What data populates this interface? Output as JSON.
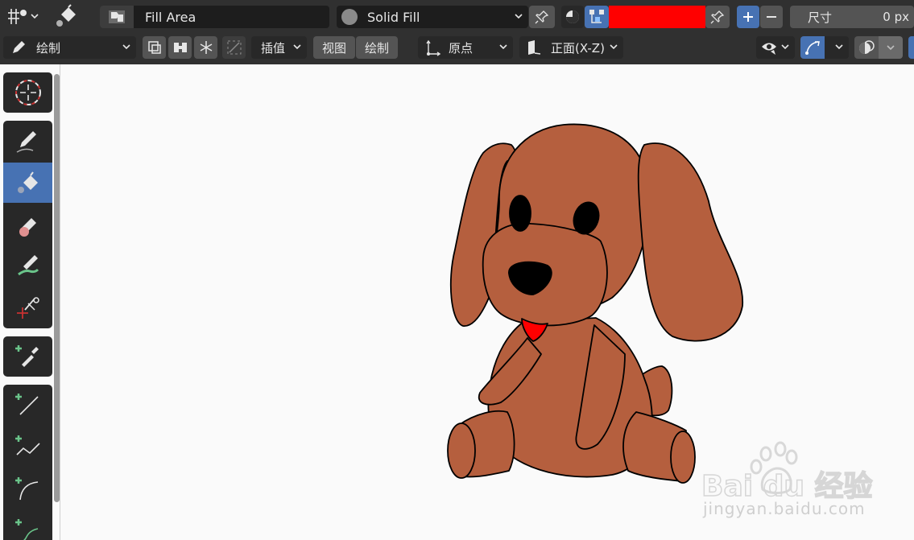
{
  "header": {
    "tool_name": "Fill Area",
    "material": "Solid Fill",
    "size_label": "尺寸",
    "size_value": "0 px",
    "color_swatch": "#ff0000"
  },
  "subheader": {
    "mode": "绘制",
    "interpolate": "插值",
    "view_tab": "视图",
    "draw_tab": "绘制",
    "pivot": "原点",
    "orientation": "正面(X-Z)"
  },
  "colors": {
    "accent": "#4772b3",
    "fur": "#b55f3e",
    "tongue": "#ff0000"
  },
  "watermark": {
    "url": "jingyan.baidu.com"
  }
}
